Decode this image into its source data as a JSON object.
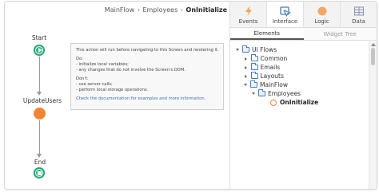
{
  "breadcrumb": {
    "items": [
      "MainFlow",
      "Employees"
    ],
    "separator": "›",
    "current": "OnInitialize"
  },
  "flow": {
    "start_label": "Start",
    "action_label": "UpdateUsers",
    "end_label": "End",
    "colors": {
      "start_end": "#27b57b",
      "action": "#f08536",
      "connector": "#9a9a9a"
    }
  },
  "note": {
    "line1": "This action will run before navigating to this Screen and rendering it.",
    "do_title": "Do:",
    "do_1": "- initialize local variables;",
    "do_2": "- any changes that do not involve the Screen's DOM.",
    "dont_title": "Don't:",
    "dont_1": "- use server calls;",
    "dont_2": "- perform local storage operations.",
    "link": "Check the documentation for examples and more information."
  },
  "panel": {
    "tabs": [
      {
        "label": "Events",
        "icon": "lightning-icon"
      },
      {
        "label": "Interface",
        "icon": "interface-icon"
      },
      {
        "label": "Logic",
        "icon": "logic-icon"
      },
      {
        "label": "Data",
        "icon": "data-grid-icon"
      }
    ],
    "active_tab": "Interface",
    "subtabs": [
      "Elements",
      "Widget Tree"
    ],
    "active_subtab": "Elements",
    "tree": {
      "root": "UI Flows",
      "items": [
        "Common",
        "Emails",
        "Layouts",
        "MainFlow"
      ],
      "screen": "Employees",
      "selected": "OnInitialize"
    },
    "accent": "#3f7fc1"
  }
}
